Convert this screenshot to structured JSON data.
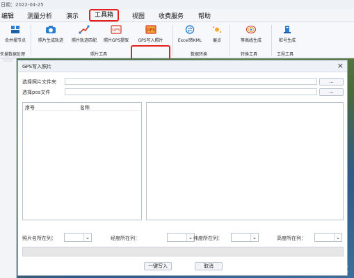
{
  "date_bar": {
    "text": "日期：2022-04-25"
  },
  "menu": {
    "items": [
      "编辑",
      "测量分析",
      "演示",
      "工具箱",
      "视图",
      "收费服务",
      "帮助"
    ],
    "active_index": 3
  },
  "ribbon": {
    "buttons": [
      {
        "label": "合并摆节点",
        "icon": "grid-icon"
      },
      {
        "label": "照片生成轨迹",
        "icon": "camera-icon"
      },
      {
        "label": "照片轨迹匹配",
        "icon": "route-icon"
      },
      {
        "label": "照片GPS提取",
        "icon": "gps-icon"
      },
      {
        "label": "GPS写入照片",
        "icon": "gps-write-icon"
      },
      {
        "label": "Excel转KML",
        "icon": "convert-icon"
      },
      {
        "label": "展点",
        "icon": "point-icon"
      },
      {
        "label": "等高线生成",
        "icon": "contour-icon"
      },
      {
        "label": "桩号生成",
        "icon": "stake-icon"
      }
    ],
    "groups": [
      "矢量数据处理",
      "照片工具",
      "数据转换",
      "转换工具",
      "工程工具"
    ]
  },
  "dialog": {
    "title": "GPS写入照片",
    "close": "×",
    "photo_folder_label": "选择照片文件夹",
    "photo_folder_value": "",
    "pos_file_label": "选择pos文件",
    "pos_file_value": "",
    "browse": "...",
    "list_headers": [
      "序号",
      "名称"
    ],
    "columns": {
      "photo_name_label": "照片名所在列：",
      "longitude_label": "经度所在列：",
      "latitude_label": "纬度所在列：",
      "altitude_label": "高度所在列：",
      "photo_name_value": "",
      "longitude_value": "",
      "latitude_value": "",
      "altitude_value": "",
      "dropdown_arrow": "⌄"
    },
    "progress": 0,
    "write_button": "一键写入",
    "cancel_button": "取消"
  },
  "watermark": "搜狐号@三维地图技术社区",
  "colors": {
    "highlight": "#e3231b",
    "ribbon_bg": "#f6f8fb",
    "dialog_bg": "#ffffff"
  }
}
